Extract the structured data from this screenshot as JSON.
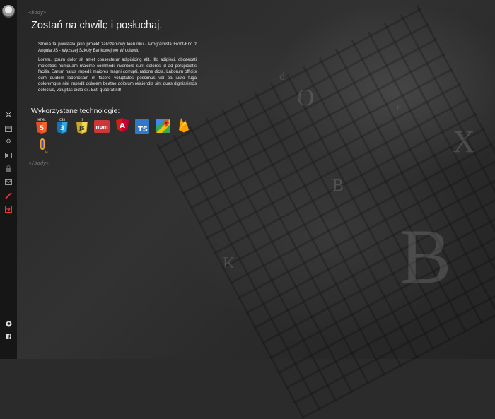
{
  "page": {
    "title": "Zostań na chwilę i posłuchaj.",
    "deco_open": "<body>",
    "deco_close": "</body>",
    "intro": "Strona ta powstała jako projekt zaliczeniowy kierunku - Programista Front-End z AngularJS - Wyższej Szkoły Bankowej we Wrocławiu",
    "lorem": "Lorem, ipsum dolor sit amet consectetur adipisicing elit. Illo adipisci, obcaecati molestias numquam maxime commodi inventore sunt dolores id ad perspiciatis facilis. Earum natus impedit maiores magni corrupti, ratione dicta. Laborum officiis eum quidem laboriosam in facere voluptates possimus vel ea iusto fuga doloremque nisi impedit dolorem beatae dolorum reiciendis sint quas dignissimos delectus, voluptas dicta ex. Est, quaerat sit!",
    "tech_heading": "Wykorzystane technologie:"
  },
  "technologies": [
    {
      "name": "HTML5",
      "icon": "html5-icon",
      "color": "#e44d26",
      "badge": "5",
      "caption": "HTML"
    },
    {
      "name": "CSS3",
      "icon": "css3-icon",
      "color": "#1572b6",
      "badge": "3",
      "caption": "CSS"
    },
    {
      "name": "JavaScript",
      "icon": "js-icon",
      "color": "#f0db4f",
      "badge": "JS",
      "caption": "JS"
    },
    {
      "name": "npm",
      "icon": "npm-icon",
      "color": "#cb3837",
      "badge": "npm",
      "caption": ""
    },
    {
      "name": "Angular",
      "icon": "angular-icon",
      "color": "#dd1b16",
      "badge": "A",
      "caption": ""
    },
    {
      "name": "TypeScript",
      "icon": "typescript-icon",
      "color": "#3178c6",
      "badge": "TS",
      "caption": ""
    },
    {
      "name": "Google Maps",
      "icon": "google-maps-icon",
      "color": "#34a853",
      "badge": "",
      "caption": ""
    },
    {
      "name": "Firebase",
      "icon": "firebase-icon",
      "color": "#ffca28",
      "badge": "",
      "caption": ""
    },
    {
      "name": "Bootstrap",
      "icon": "bootstrap-icon",
      "color": "#f5a623",
      "badge": "",
      "caption": ""
    }
  ],
  "sidebar": {
    "items": [
      {
        "name": "sidebar-item-about",
        "icon": "smiley-icon",
        "active": true
      },
      {
        "name": "sidebar-item-calendar",
        "icon": "calendar-icon"
      },
      {
        "name": "sidebar-item-settings",
        "icon": "gear-icon"
      },
      {
        "name": "sidebar-item-card",
        "icon": "id-card-icon"
      },
      {
        "name": "sidebar-item-security",
        "icon": "lock-icon"
      },
      {
        "name": "sidebar-item-mail",
        "icon": "mail-icon"
      },
      {
        "name": "sidebar-item-edit",
        "icon": "pencil-icon"
      },
      {
        "name": "sidebar-item-logout",
        "icon": "sign-out-icon"
      }
    ],
    "footer": [
      {
        "name": "github-link",
        "icon": "github-icon"
      },
      {
        "name": "facebook-link",
        "icon": "facebook-icon"
      }
    ]
  },
  "colors": {
    "sidebar_bg": "#161616",
    "accent_red": "#e53935",
    "text": "#e8e8e8"
  }
}
